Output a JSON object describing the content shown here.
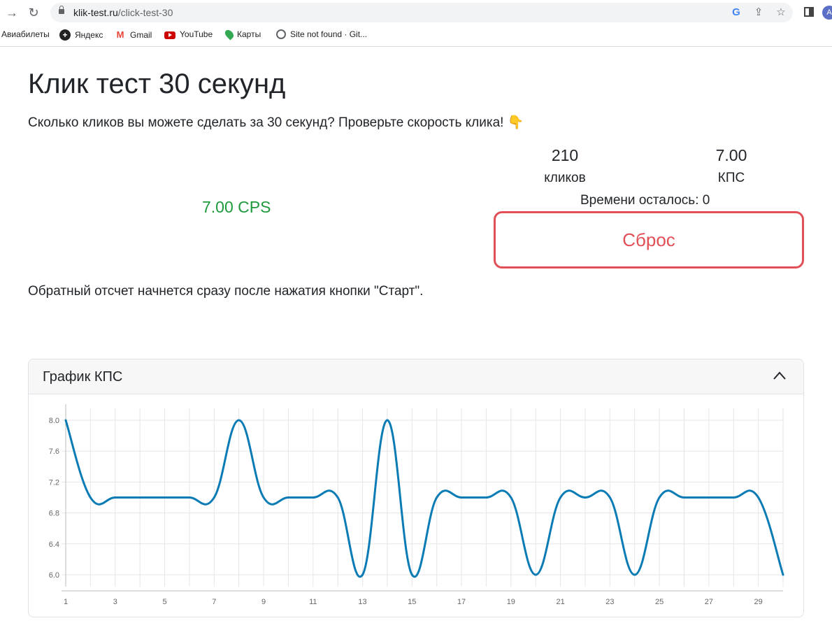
{
  "browser": {
    "url_host": "klik-test.ru",
    "url_path": "/click-test-30",
    "avatar_letter": "A",
    "bookmarks": [
      {
        "label": "Авиабилеты",
        "icon": "none"
      },
      {
        "label": "Яндекс",
        "icon": "yandex-icon"
      },
      {
        "label": "Gmail",
        "icon": "gmail-icon"
      },
      {
        "label": "YouTube",
        "icon": "youtube-icon"
      },
      {
        "label": "Карты",
        "icon": "maps-pin-icon"
      },
      {
        "label": "Site not found · Git...",
        "icon": "globe-icon"
      }
    ]
  },
  "page": {
    "title": "Клик тест 30 секунд",
    "subtitle": "Сколько кликов вы можете сделать за 30 секунд? Проверьте скорость клика! 👇",
    "cps_display": "7.00 CPS",
    "clicks_value": "210",
    "clicks_label": "кликов",
    "cps_value": "7.00",
    "cps_label": "КПС",
    "time_left": "Времени осталось: 0",
    "reset_label": "Сброс",
    "note": "Обратный отсчет начнется сразу после нажатия кнопки \"Старт\"."
  },
  "chart_card": {
    "title": "График КПС"
  },
  "colors": {
    "cps_green": "#1e9a3d",
    "reset_red": "#e24f57",
    "line_blue": "#0a7bb4"
  },
  "chart_data": {
    "type": "line",
    "title": "",
    "xlabel": "",
    "ylabel": "",
    "x": [
      1,
      2,
      3,
      4,
      5,
      6,
      7,
      8,
      9,
      10,
      11,
      12,
      13,
      14,
      15,
      16,
      17,
      18,
      19,
      20,
      21,
      22,
      23,
      24,
      25,
      26,
      27,
      28,
      29,
      30
    ],
    "x_tick_labels": [
      "1",
      "3",
      "5",
      "7",
      "9",
      "11",
      "13",
      "15",
      "17",
      "19",
      "21",
      "23",
      "25",
      "27",
      "29"
    ],
    "y_tick_labels": [
      "6.0",
      "6.4",
      "6.8",
      "7.2",
      "7.6",
      "8.0"
    ],
    "ylim": [
      5.9,
      8.1
    ],
    "grid": true,
    "series": [
      {
        "values": [
          8,
          7,
          7,
          7,
          7,
          7,
          7,
          8,
          7,
          7,
          7,
          7,
          6,
          8,
          6,
          7,
          7,
          7,
          7,
          6,
          7,
          7,
          7,
          6,
          7,
          7,
          7,
          7,
          7,
          6
        ]
      }
    ]
  }
}
